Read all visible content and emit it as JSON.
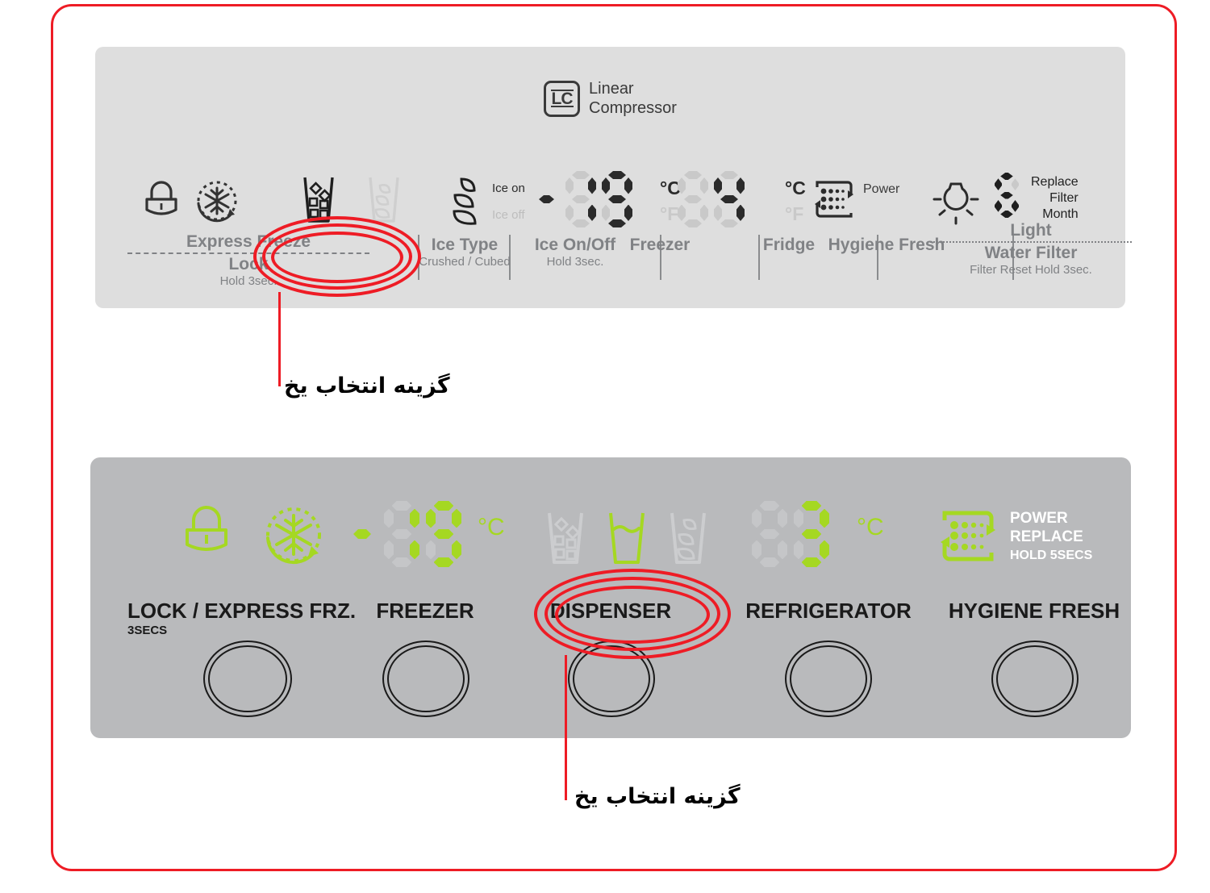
{
  "frame": {
    "accent_color": "#ee1c25"
  },
  "top_panel": {
    "background": "#dedede",
    "brand": {
      "logo_text": "LC",
      "line1": "Linear",
      "line2": "Compressor"
    },
    "displays": {
      "freezer": {
        "sign": "-",
        "digits": "19",
        "unit_active": "°C",
        "unit_inactive": "°F"
      },
      "fridge": {
        "digits": "4",
        "unit_active": "°C",
        "unit_inactive": "°F"
      },
      "filter_month": {
        "value": "6",
        "label_line1": "Replace",
        "label_line2": "Filter",
        "label_line3": "Month"
      },
      "hygiene": {
        "label": "Power"
      },
      "ice_state": {
        "on_label": "Ice on",
        "off_label": "Ice off"
      }
    },
    "buttons": [
      {
        "id": "express-freeze-lock",
        "line1": "Express Freeze",
        "line2": "Lock",
        "line3": "Hold 3sec."
      },
      {
        "id": "ice-type",
        "line1": "Ice Type",
        "line2": "Crushed / Cubed"
      },
      {
        "id": "ice-on-off",
        "line1": "Ice On/Off",
        "line2": "Hold 3sec."
      },
      {
        "id": "freezer",
        "line1": "Freezer"
      },
      {
        "id": "fridge",
        "line1": "Fridge"
      },
      {
        "id": "hygiene-fresh",
        "line1": "Hygiene Fresh"
      },
      {
        "id": "light-water-filter",
        "line1": "Light",
        "line2": "Water Filter",
        "line3": "Filter Reset Hold 3sec."
      }
    ]
  },
  "bottom_panel": {
    "background": "#b9babc",
    "led_color": "#a5d822",
    "displays": {
      "freezer": {
        "sign": "-",
        "digits": "19",
        "unit": "°C"
      },
      "refrigerator": {
        "digits": "3",
        "unit": "°C"
      },
      "hygiene": {
        "line1": "POWER",
        "line2": "REPLACE",
        "line3": "HOLD 5SECS"
      }
    },
    "buttons": [
      {
        "id": "lock-express-frz",
        "label": "LOCK / EXPRESS FRZ.",
        "sub": "3SECS"
      },
      {
        "id": "freezer",
        "label": "FREEZER",
        "sub": ""
      },
      {
        "id": "dispenser",
        "label": "DISPENSER",
        "sub": ""
      },
      {
        "id": "refrigerator",
        "label": "REFRIGERATOR",
        "sub": ""
      },
      {
        "id": "hygiene-fresh",
        "label": "HYGIENE FRESH",
        "sub": ""
      }
    ]
  },
  "annotations": [
    {
      "id": "top-ice-type",
      "text": "گزینه انتخاب یخ"
    },
    {
      "id": "bottom-dispenser",
      "text": "گزینه انتخاب یخ"
    }
  ]
}
